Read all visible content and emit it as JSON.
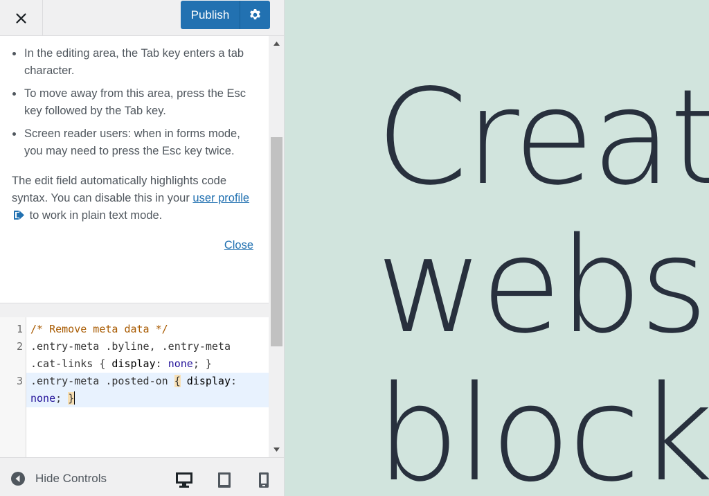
{
  "header": {
    "close_icon": "close-x-icon",
    "publish_label": "Publish",
    "settings_icon": "gear-icon",
    "accent": "#2271b1"
  },
  "help": {
    "items": [
      "In the editing area, the Tab key enters a tab character.",
      "To move away from this area, press the Esc key followed by the Tab key.",
      "Screen reader users: when in forms mode, you may need to press the Esc key twice."
    ],
    "note_before": "The edit field automatically highlights code syntax. You can disable this in your ",
    "note_link": "user profile",
    "note_after": " to work in plain text mode.",
    "external_icon": "external-link-icon",
    "close_label": "Close"
  },
  "editor": {
    "line_numbers": [
      "1",
      "2",
      "3"
    ],
    "line1": "/* Remove meta data */",
    "line2a_selector": ".entry-meta .byline, .entry-meta",
    "line2b_selector": ".cat-links ",
    "line2b_open": "{ ",
    "line2b_prop": "display",
    "line2b_colon": ": ",
    "line2b_value": "none",
    "line2b_close": "; }",
    "line3a_selector": ".entry-meta .posted-on ",
    "line3a_brace": "{",
    "line3a_prop": " display",
    "line3a_colon": ":",
    "line3b_value": "none",
    "line3b_semi": "; ",
    "line3b_brace": "}"
  },
  "footer": {
    "hide_controls_label": "Hide Controls",
    "hide_icon": "arrow-left-circle-icon",
    "devices": [
      "desktop-icon",
      "tablet-icon",
      "mobile-icon"
    ]
  },
  "preview": {
    "hero_lines": [
      "Create",
      "websit",
      "blocks"
    ],
    "background": "#d1e4dd",
    "text_color": "#28303d"
  }
}
